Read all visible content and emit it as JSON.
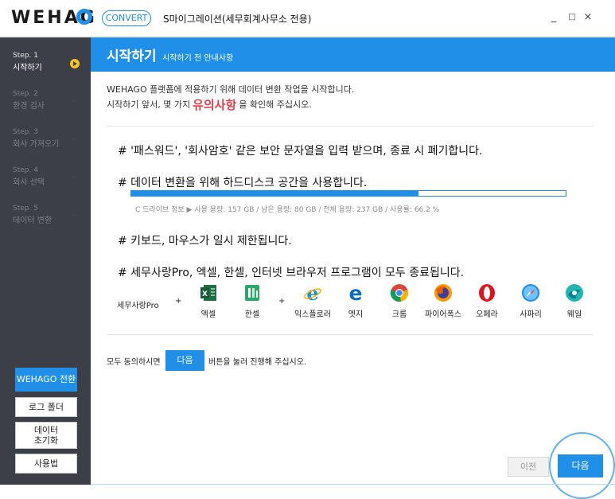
{
  "titlebar": {
    "logo": "WEHAG",
    "convert_label": "CONVERT",
    "app_title": "S마이그레이션(세무회계사무소 전용)",
    "minimize": "_",
    "maximize": "□",
    "close": "×"
  },
  "sidebar": {
    "steps": [
      {
        "num": "Step. 1",
        "name": "시작하기",
        "active": true
      },
      {
        "num": "Step. 2",
        "name": "환경 검사",
        "active": false
      },
      {
        "num": "Step. 3",
        "name": "회사 가져오기",
        "active": false
      },
      {
        "num": "Step. 4",
        "name": "회사 선택",
        "active": false
      },
      {
        "num": "Step. 5",
        "name": "데이터 변환",
        "active": false
      }
    ],
    "wehago_switch": "WEHAGO 전환",
    "log_folder": "로그 폴더",
    "data_reset_1": "데이터",
    "data_reset_2": "초기화",
    "usage": "사용법"
  },
  "header": {
    "title": "시작하기",
    "subtitle": "시작하기 전 안내사항"
  },
  "intro": {
    "line1": "WEHAGO 플랫폼에 적용하기 위해 데이터 변환 작업을 시작합니다.",
    "line2_pre": "시작하기 앞서, 몇 가지",
    "line2_emph": "유의사항",
    "line2_post": "을 확인해 주십시오."
  },
  "notices": {
    "n1": "# '패스워드', '회사암호' 같은 보안 문자열을 입력 받으며, 종료 시 폐기합니다.",
    "n2": "# 데이터 변환을 위해 하드디스크 공간을 사용합니다.",
    "n3": "# 키보드, 마우스가 일시 제한됩니다.",
    "n4": "# 세무사랑Pro, 엑셀, 한셀, 인터넷 브라우저 프로그램이 모두 종료됩니다."
  },
  "disk": {
    "info": "C 드라이브 정보 ▶ 사용 용량: 157 GB / 남은 용량: 80 GB / 전체 용량: 237 GB / 사용률: 66.2 %",
    "usage_percent": 66.2
  },
  "programs": {
    "lead": "세무사랑Pro",
    "plus": "+",
    "apps": [
      {
        "name": "엑셀",
        "icon": "excel-icon",
        "color": "#1e7145"
      },
      {
        "name": "한셀",
        "icon": "hancell-icon",
        "color": "#2fa66a"
      },
      {
        "name": "익스플로러",
        "icon": "internet-explorer-icon",
        "color": "#1e90e0"
      },
      {
        "name": "엣지",
        "icon": "edge-icon",
        "color": "#0f6cc1"
      },
      {
        "name": "크롬",
        "icon": "chrome-icon",
        "color": "#db4437"
      },
      {
        "name": "파이어폭스",
        "icon": "firefox-icon",
        "color": "#e66000"
      },
      {
        "name": "오페라",
        "icon": "opera-icon",
        "color": "#e0131d"
      },
      {
        "name": "사파리",
        "icon": "safari-icon",
        "color": "#1a8cf0"
      },
      {
        "name": "웨일",
        "icon": "whale-icon",
        "color": "#1fb7b0"
      }
    ]
  },
  "agree": {
    "pre": "모두 동의하시면",
    "button": "다음",
    "post": "버튼을 눌러 진행해 주십시오."
  },
  "footer": {
    "prev": "이전",
    "next": "다음"
  },
  "colors": {
    "accent": "#1f8fe8",
    "sidebar_bg": "#3c3e48",
    "caution": "#e8414b",
    "active_dot": "#f5c518"
  }
}
